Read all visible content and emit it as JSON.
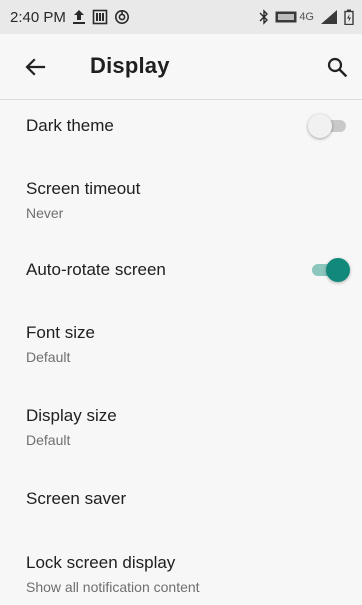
{
  "status_bar": {
    "time": "2:40 PM",
    "left_icons": [
      "upload-icon",
      "sim-card-icon",
      "sync-icon"
    ],
    "right_text": "4G",
    "right_icons": [
      "bluetooth-icon",
      "volte-icon",
      "signal-icon",
      "battery-icon"
    ]
  },
  "app_bar": {
    "title": "Display",
    "back_icon": "back-arrow-icon",
    "search_icon": "search-icon"
  },
  "settings": {
    "dark_theme": {
      "title": "Dark theme",
      "enabled": false
    },
    "screen_timeout": {
      "title": "Screen timeout",
      "summary": "Never"
    },
    "auto_rotate": {
      "title": "Auto-rotate screen",
      "enabled": true
    },
    "font_size": {
      "title": "Font size",
      "summary": "Default"
    },
    "display_size": {
      "title": "Display size",
      "summary": "Default"
    },
    "screen_saver": {
      "title": "Screen saver"
    },
    "lock_screen": {
      "title": "Lock screen display",
      "summary": "Show all notification content"
    }
  },
  "colors": {
    "accent": "#10897a",
    "accent_track": "#8cc7bd",
    "background": "#f7f7f7",
    "status_bar": "#e9e9e9"
  }
}
